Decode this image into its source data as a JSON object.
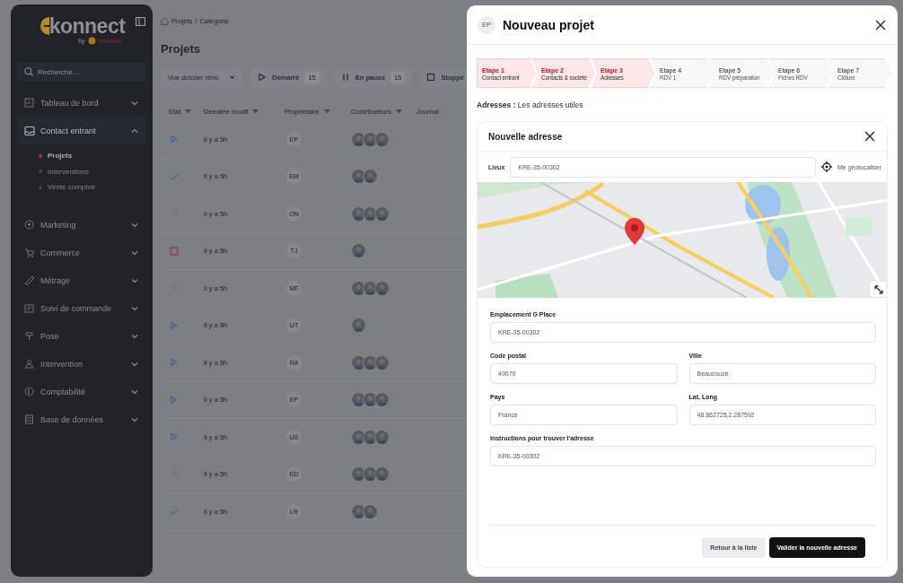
{
  "sidebar": {
    "logo": "konnect",
    "logo_by": "by",
    "logo_brand": "kamilo",
    "search": {
      "placeholder": "Recherche..."
    },
    "items": [
      {
        "label": "Tableau de bord",
        "expanded": false
      },
      {
        "label": "Contact entrant",
        "expanded": true,
        "children": [
          {
            "label": "Projets",
            "selected": true
          },
          {
            "label": "Interventions",
            "selected": false
          },
          {
            "label": "Vente comptoir",
            "selected": false
          }
        ]
      },
      {
        "label": "Marketing",
        "expanded": false
      },
      {
        "label": "Commerce",
        "expanded": false
      },
      {
        "label": "Métrage",
        "expanded": false
      },
      {
        "label": "Suivi de commande",
        "expanded": false
      },
      {
        "label": "Pose",
        "expanded": false
      },
      {
        "label": "Intervention",
        "expanded": false
      },
      {
        "label": "Comptabilité",
        "expanded": false
      },
      {
        "label": "Base de données",
        "expanded": false
      }
    ]
  },
  "main": {
    "breadcrumb": [
      "Projets",
      "/",
      "Catégorie"
    ],
    "title": "Projets",
    "view_select": "Vue dossier réno",
    "filters": [
      {
        "kind": "started",
        "label": "Démarré",
        "count": "15"
      },
      {
        "kind": "paused",
        "label": "En pause",
        "count": "15"
      },
      {
        "kind": "stopped",
        "label": "Stoppé"
      }
    ],
    "columns": [
      "Etat",
      "Dernière modif",
      "Propriétaire",
      "Contributeurs",
      "Journal"
    ],
    "rows": [
      {
        "kind": "started",
        "modified": "Il y a 5h",
        "owner": "EP",
        "contributors": [
          {
            "kind": "avatar"
          },
          {
            "kind": "avatar"
          },
          {
            "kind": "avatar"
          }
        ]
      },
      {
        "kind": "done",
        "modified": "Il y a 5h",
        "owner": "EM",
        "contributors": [
          {
            "kind": "avatar"
          },
          {
            "kind": "avatar"
          }
        ]
      },
      {
        "kind": "paused",
        "modified": "Il y a 5h",
        "owner": "ON",
        "contributors": [
          {
            "kind": "avatar"
          },
          {
            "kind": "avatar"
          },
          {
            "kind": "avatar"
          }
        ]
      },
      {
        "kind": "stopped",
        "modified": "Il y a 5h",
        "owner": "TJ",
        "contributors": [
          {
            "kind": "avatar"
          }
        ]
      },
      {
        "kind": "paused",
        "modified": "Il y a 5h",
        "owner": "MF",
        "contributors": [
          {
            "kind": "avatar"
          },
          {
            "kind": "avatar"
          },
          {
            "kind": "avatar"
          }
        ]
      },
      {
        "kind": "started",
        "modified": "Il y a 5h",
        "owner": "UT",
        "contributors": [
          {
            "kind": "avatar"
          }
        ]
      },
      {
        "kind": "started",
        "modified": "Il y a 5h",
        "owner": "RA",
        "contributors": [
          {
            "kind": "avatar"
          },
          {
            "kind": "avatar"
          },
          {
            "kind": "avatar"
          }
        ]
      },
      {
        "kind": "started",
        "modified": "Il y a 5h",
        "owner": "EP",
        "contributors": [
          {
            "kind": "avatar"
          },
          {
            "kind": "avatar"
          },
          {
            "kind": "avatar"
          }
        ]
      },
      {
        "kind": "started",
        "modified": "Il y a 5h",
        "owner": "US",
        "contributors": [
          {
            "kind": "avatar"
          },
          {
            "kind": "avatar"
          },
          {
            "kind": "avatar"
          }
        ]
      },
      {
        "kind": "paused",
        "modified": "Il y a 5h",
        "owner": "ED",
        "contributors": [
          {
            "kind": "avatar"
          },
          {
            "kind": "avatar"
          },
          {
            "kind": "avatar"
          }
        ]
      },
      {
        "kind": "done",
        "modified": "Il y a 5h",
        "owner": "LR",
        "contributors": [
          {
            "kind": "avatar"
          },
          {
            "kind": "avatar"
          }
        ]
      }
    ]
  },
  "modal": {
    "badge": "EP",
    "title": "Nouveau projet",
    "steps": [
      {
        "title": "Etape 1",
        "subtitle": "Contact entrant",
        "done": true
      },
      {
        "title": "Etape 2",
        "subtitle": "Contacts & société",
        "done": true
      },
      {
        "title": "Etape 3",
        "subtitle": "Adresses",
        "done": true
      },
      {
        "title": "Etape 4",
        "subtitle": "RDV 1",
        "done": false
      },
      {
        "title": "Etape 5",
        "subtitle": "RDV préparation",
        "done": false
      },
      {
        "title": "Etape 6",
        "subtitle": "Fiches RDV",
        "done": false
      },
      {
        "title": "Etape 7",
        "subtitle": "Clôture",
        "done": false
      }
    ],
    "section": "**Adresses :** Les adresses utiles",
    "card": {
      "title": "Nouvelle adresse",
      "place_label": "Lieux",
      "place_value": "KRE-35-00302",
      "geolocate": "Me géolocaliser",
      "fields": [
        {
          "label": "Emplacement G Place",
          "value": "KRE-35-00302",
          "kind": "wide"
        },
        {
          "label": "Code postal",
          "value": "49070",
          "kind": "half"
        },
        {
          "label": "Ville",
          "value": "Beaucouzé",
          "kind": "half"
        },
        {
          "label": "Pays",
          "value": "France",
          "kind": "half"
        },
        {
          "label": "Lat, Long",
          "value": "48.862725,2.287592",
          "kind": "half"
        },
        {
          "label": "Instructions pour trouver l'adresse",
          "value": "KRE-35-00302",
          "kind": "wide"
        }
      ],
      "buttons": [
        {
          "kind": "secondary",
          "label": "Retour à la liste"
        },
        {
          "kind": "primary",
          "label": "Valider la nouvelle adresse"
        }
      ]
    }
  }
}
